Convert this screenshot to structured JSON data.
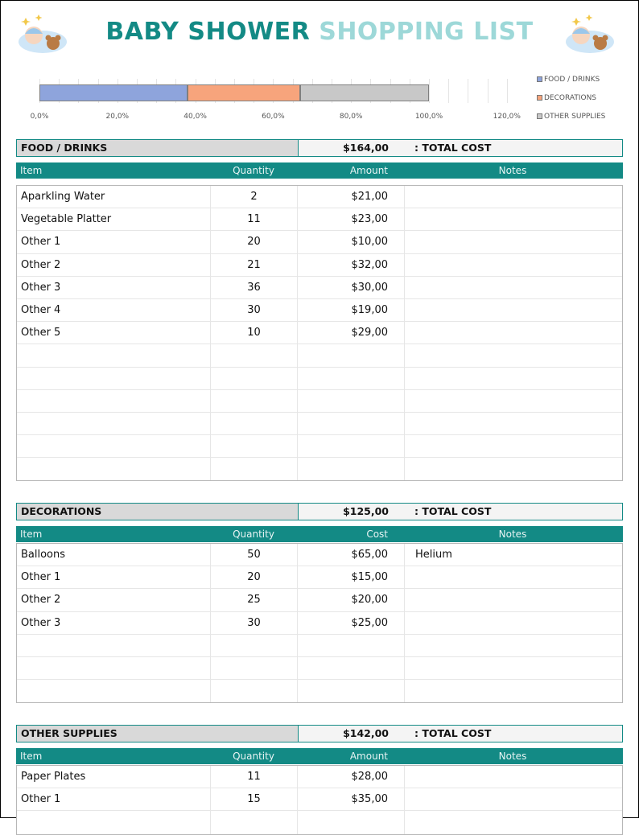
{
  "header": {
    "title_part1": "BABY SHOWER",
    "title_part2": "SHOPPING LIST",
    "left_image": "baby-teddy-illustration",
    "right_image": "baby-teddy-illustration"
  },
  "chart_data": {
    "type": "bar",
    "orientation": "horizontal-stacked",
    "series": [
      {
        "name": "FOOD / DRINKS",
        "value": 0.38,
        "color": "#8ea4dc"
      },
      {
        "name": "DECORATIONS",
        "value": 0.29,
        "color": "#f7a47c"
      },
      {
        "name": "OTHER SUPPLIES",
        "value": 0.33,
        "color": "#c8c8c8"
      }
    ],
    "xlim": [
      0,
      1.2
    ],
    "ticks": [
      "0,0%",
      "20,0%",
      "40,0%",
      "60,0%",
      "80,0%",
      "100,0%",
      "120,0%"
    ],
    "legend_position": "right"
  },
  "sections": [
    {
      "name": "FOOD / DRINKS",
      "total": "$164,00",
      "total_label": ": TOTAL COST",
      "headers": {
        "item": "Item",
        "quantity": "Quantity",
        "amount": "Amount",
        "notes": "Notes"
      },
      "rows": [
        {
          "item": "Aparkling Water",
          "quantity": "2",
          "amount": "$21,00",
          "notes": ""
        },
        {
          "item": "Vegetable Platter",
          "quantity": "11",
          "amount": "$23,00",
          "notes": ""
        },
        {
          "item": "Other 1",
          "quantity": "20",
          "amount": "$10,00",
          "notes": ""
        },
        {
          "item": "Other 2",
          "quantity": "21",
          "amount": "$32,00",
          "notes": ""
        },
        {
          "item": "Other 3",
          "quantity": "36",
          "amount": "$30,00",
          "notes": ""
        },
        {
          "item": "Other 4",
          "quantity": "30",
          "amount": "$19,00",
          "notes": ""
        },
        {
          "item": "Other 5",
          "quantity": "10",
          "amount": "$29,00",
          "notes": ""
        },
        {
          "item": "",
          "quantity": "",
          "amount": "",
          "notes": ""
        },
        {
          "item": "",
          "quantity": "",
          "amount": "",
          "notes": ""
        },
        {
          "item": "",
          "quantity": "",
          "amount": "",
          "notes": ""
        },
        {
          "item": "",
          "quantity": "",
          "amount": "",
          "notes": ""
        },
        {
          "item": "",
          "quantity": "",
          "amount": "",
          "notes": ""
        },
        {
          "item": "",
          "quantity": "",
          "amount": "",
          "notes": ""
        }
      ]
    },
    {
      "name": "DECORATIONS",
      "total": "$125,00",
      "total_label": ": TOTAL COST",
      "headers": {
        "item": "Item",
        "quantity": "Quantity",
        "amount": "Cost",
        "notes": "Notes"
      },
      "rows": [
        {
          "item": "Balloons",
          "quantity": "50",
          "amount": "$65,00",
          "notes": "Helium"
        },
        {
          "item": "Other 1",
          "quantity": "20",
          "amount": "$15,00",
          "notes": ""
        },
        {
          "item": "Other 2",
          "quantity": "25",
          "amount": "$20,00",
          "notes": ""
        },
        {
          "item": "Other 3",
          "quantity": "30",
          "amount": "$25,00",
          "notes": ""
        },
        {
          "item": "",
          "quantity": "",
          "amount": "",
          "notes": ""
        },
        {
          "item": "",
          "quantity": "",
          "amount": "",
          "notes": ""
        },
        {
          "item": "",
          "quantity": "",
          "amount": "",
          "notes": ""
        }
      ]
    },
    {
      "name": "OTHER SUPPLIES",
      "total": "$142,00",
      "total_label": ": TOTAL COST",
      "headers": {
        "item": "Item",
        "quantity": "Quantity",
        "amount": "Amount",
        "notes": "Notes"
      },
      "rows": [
        {
          "item": "Paper Plates",
          "quantity": "11",
          "amount": "$28,00",
          "notes": ""
        },
        {
          "item": "Other 1",
          "quantity": "15",
          "amount": "$35,00",
          "notes": ""
        },
        {
          "item": "",
          "quantity": "",
          "amount": "",
          "notes": ""
        }
      ]
    }
  ]
}
